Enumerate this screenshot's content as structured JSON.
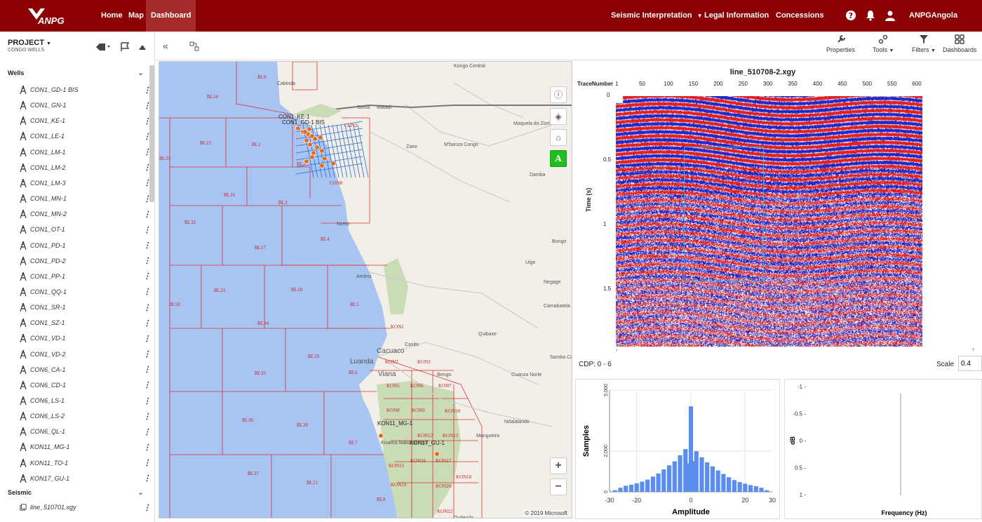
{
  "header": {
    "brand": "ANPG",
    "nav": [
      {
        "label": "Home"
      },
      {
        "label": "Map"
      },
      {
        "label": "Dashboard"
      }
    ],
    "right_nav": [
      {
        "label": "Seismic Interpretation"
      },
      {
        "label": "Legal Information"
      },
      {
        "label": "Concessions"
      }
    ],
    "user": "ANPGAngola"
  },
  "sidebar": {
    "project_label": "PROJECT",
    "project_name": "CONGO WELLS",
    "wells_title": "Wells",
    "wells": [
      "CON1_GD-1 BIS",
      "CON1_GN-1",
      "CON1_KE-1",
      "CON1_LE-1",
      "CON1_LM-1",
      "CON1_LM-2",
      "CON1_LM-3",
      "CON1_MN-1",
      "CON1_MN-2",
      "CON1_OT-1",
      "CON1_PD-1",
      "CON1_PD-2",
      "CON1_PP-1",
      "CON1_QQ-1",
      "CON1_SR-1",
      "CON1_SZ-1",
      "CON1_VD-1",
      "CON1_VD-2",
      "CON6_CA-1",
      "CON6_CD-1",
      "CON6_LS-1",
      "CON6_LS-2",
      "CON6_QL-1",
      "KON11_MG-1",
      "KON11_TO-1",
      "KON17_GU-1"
    ],
    "seismic_title": "Seismic",
    "seismic": [
      "line_510701.xgy"
    ]
  },
  "toolbar": {
    "properties": "Properties",
    "tools": "Tools",
    "filters": "Filters",
    "dashboards": "Dashboards"
  },
  "map": {
    "copyright": "© 2019 Microsoft",
    "zoom_in": "+",
    "zoom_out": "−",
    "a_btn": "A",
    "places": [
      {
        "t": "Kongo Central"
      },
      {
        "t": "Cabinda"
      },
      {
        "t": "Soma"
      },
      {
        "t": "Matadi"
      },
      {
        "t": "Maquela do Zombo"
      },
      {
        "t": "Zaire"
      },
      {
        "t": "M'banza Congo"
      },
      {
        "t": "Damba"
      },
      {
        "t": "Nzeto"
      },
      {
        "t": "Bungo"
      },
      {
        "t": "Uige"
      },
      {
        "t": "Negage"
      },
      {
        "t": "Ambriz"
      },
      {
        "t": "Camabatela"
      },
      {
        "t": "Quibaxe"
      },
      {
        "t": "Caxito"
      },
      {
        "t": "Cacuaco"
      },
      {
        "t": "Luanda"
      },
      {
        "t": "Viana"
      },
      {
        "t": "Samba Caju"
      },
      {
        "t": "Cuanza Norte"
      },
      {
        "t": "Bengo"
      },
      {
        "t": "Ndalatando"
      },
      {
        "t": "Mangueira"
      },
      {
        "t": "Kisama National Park"
      },
      {
        "t": "Quilenda"
      }
    ],
    "blocks": [
      {
        "t": "BL0"
      },
      {
        "t": "BL14"
      },
      {
        "t": "BL15"
      },
      {
        "t": "BL1"
      },
      {
        "t": "BL31"
      },
      {
        "t": "BL2"
      },
      {
        "t": "BL16"
      },
      {
        "t": "BL3"
      },
      {
        "t": "BL32"
      },
      {
        "t": "BL17"
      },
      {
        "t": "BL4"
      },
      {
        "t": "BL33"
      },
      {
        "t": "BL18"
      },
      {
        "t": "BL5"
      },
      {
        "t": "BL50"
      },
      {
        "t": "BL34"
      },
      {
        "t": "BL19"
      },
      {
        "t": "BL35"
      },
      {
        "t": "BL6"
      },
      {
        "t": "BL36"
      },
      {
        "t": "BL20"
      },
      {
        "t": "BL7"
      },
      {
        "t": "BL37"
      },
      {
        "t": "BL21"
      },
      {
        "t": "BL8"
      },
      {
        "t": "CON8"
      },
      {
        "t": "CON2"
      },
      {
        "t": "KON1"
      },
      {
        "t": "KON2"
      },
      {
        "t": "KON3"
      },
      {
        "t": "KON5"
      },
      {
        "t": "KON6"
      },
      {
        "t": "KON7"
      },
      {
        "t": "KON8"
      },
      {
        "t": "KON9"
      },
      {
        "t": "KON10"
      },
      {
        "t": "KON12"
      },
      {
        "t": "KON13"
      },
      {
        "t": "KON15"
      },
      {
        "t": "KON16"
      },
      {
        "t": "KON17"
      },
      {
        "t": "KON18"
      },
      {
        "t": "KON19"
      },
      {
        "t": "KON20"
      },
      {
        "t": "KON22"
      }
    ],
    "well_labels": [
      {
        "t": "CON1_KE-1"
      },
      {
        "t": "CON1_GD-1 BIS"
      },
      {
        "t": "KON11_MG-1"
      },
      {
        "t": "KON17_GU-1"
      }
    ]
  },
  "seismic": {
    "title": "line_510708-2.xgy",
    "trace_label": "TraceNumber",
    "x_ticks": [
      "1",
      "50",
      "100",
      "150",
      "200",
      "250",
      "300",
      "350",
      "400",
      "450",
      "500",
      "550",
      "600"
    ],
    "y_label": "Time (s)",
    "y_ticks": [
      "0",
      "0.5",
      "1",
      "1.5"
    ],
    "cdp": "CDP: 0 - 6",
    "scale_label": "Scale",
    "scale_value": "0.4"
  },
  "chart_data": [
    {
      "type": "bar",
      "xlabel": "Amplitude",
      "ylabel": "Samples",
      "xlim": [
        -30,
        30
      ],
      "ylim": [
        0,
        5000
      ],
      "x_ticks": [
        "-30",
        "-20",
        "0",
        "20",
        "30"
      ],
      "y_ticks": [
        "5,000",
        "2,000",
        "0"
      ],
      "x": [
        -28,
        -26,
        -24,
        -22,
        -20,
        -18,
        -16,
        -14,
        -12,
        -10,
        -8,
        -6,
        -4,
        -2,
        -1,
        0,
        1,
        2,
        4,
        6,
        8,
        10,
        12,
        14,
        16,
        18,
        20,
        22,
        24,
        26,
        28
      ],
      "values": [
        80,
        200,
        300,
        350,
        420,
        500,
        600,
        750,
        900,
        1100,
        1300,
        1500,
        1800,
        2100,
        1400,
        4200,
        1500,
        2000,
        1700,
        1450,
        1250,
        1050,
        880,
        720,
        580,
        480,
        400,
        330,
        280,
        200,
        80
      ],
      "color": "#5b8def"
    },
    {
      "type": "line",
      "xlabel": "Frequency (Hz)",
      "ylabel": "dB",
      "y_ticks": [
        "-1",
        "-0.5",
        "0",
        "0.5",
        "1"
      ],
      "ylim": [
        -1,
        1
      ]
    }
  ]
}
